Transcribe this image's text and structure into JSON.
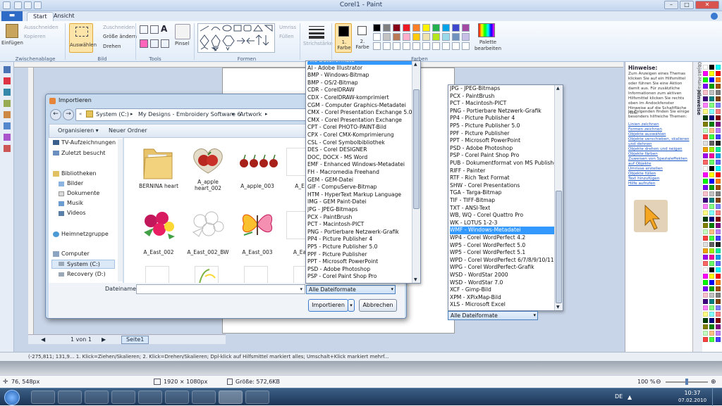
{
  "window": {
    "title": "Corel1 - Paint"
  },
  "tabs": {
    "menu": "▬",
    "start": "Start",
    "view": "Ansicht"
  },
  "ribbon": {
    "clipboard": {
      "paste": "Einfügen",
      "cut": "Ausschneiden",
      "copy": "Kopieren",
      "label": "Zwischenablage"
    },
    "image": {
      "select": "Auswählen",
      "crop": "Zuschneiden",
      "resize": "Größe ändern",
      "rotate": "Drehen",
      "label": "Bild"
    },
    "tools": {
      "label": "Tools"
    },
    "brushes": {
      "label": "Pinsel"
    },
    "shapes": {
      "outline": "Umriss",
      "fill": "Füllen",
      "label": "Formen"
    },
    "size": {
      "label": "Strichstärke"
    },
    "colors": {
      "color1": "1. Farbe",
      "color2": "2. Farbe",
      "edit": "Palette bearbeiten",
      "label": "Farben",
      "row1": [
        "#000000",
        "#7f7f7f",
        "#880015",
        "#ed1c24",
        "#ff7f27",
        "#fff200",
        "#22b14c",
        "#00a2e8",
        "#3f48cc",
        "#a349a4"
      ],
      "row2": [
        "#ffffff",
        "#c3c3c3",
        "#b97a57",
        "#ffaec9",
        "#ffc90e",
        "#efe4b0",
        "#b5e61d",
        "#99d9ea",
        "#7092be",
        "#c8bfe7"
      ]
    }
  },
  "dialog": {
    "title": "Importieren",
    "path": [
      "System (C:)",
      "My Designs - Embroidery Software 6",
      "Artwork"
    ],
    "organize": "Organisieren",
    "new_folder": "Neuer Ordner",
    "nav": [
      "TV-Aufzeichnungen",
      "Zuletzt besucht",
      "Bibliotheken",
      "Bilder",
      "Dokumente",
      "Musik",
      "Videos",
      "Heimnetzgruppe",
      "Computer",
      "System (C:)",
      "Recovery (D:)"
    ],
    "files": [
      "BERNINA heart",
      "A_apple heart_002",
      "A_apple_003",
      "A_E",
      "A_East_002",
      "A_East_002_BW",
      "A_East_003",
      "A_Ea"
    ],
    "filename_label": "Dateiname:",
    "filename_value": "",
    "filter": "Alle Dateiformate",
    "import_btn": "Importieren",
    "cancel_btn": "Abbrechen"
  },
  "list1": {
    "items": [
      "Alle Dateiformate",
      "AI - Adobe Illustrator",
      "BMP - Windows-Bitmap",
      "BMP - OS/2-Bitmap",
      "CDR - CorelDRAW",
      "CDX - CorelDRAW-komprimiert",
      "CGM - Computer Graphics-Metadatei",
      "CMX - Corel Presentation Exchange 5.0",
      "CMX - Corel Presentation Exchange",
      "CPT - Corel PHOTO-PAINT-Bild",
      "CPX - Corel CMX-Komprimierung",
      "CSL - Corel Symbolbibliothek",
      "DES - Corel DESIGNER",
      "DOC, DOCX - MS Word",
      "EMF - Enhanced Windows-Metadatei",
      "FH - Macromedia Freehand",
      "GEM - GEM-Datei",
      "GIF - CompuServe-Bitmap",
      "HTM - HyperText Markup Language",
      "IMG - GEM Paint-Datei",
      "JPG - JPEG-Bitmaps",
      "PCX - PaintBrush",
      "PCT - Macintosh-PICT",
      "PNG - Portierbare Netzwerk-Grafik",
      "PP4 - Picture Publisher 4",
      "PP5 - Picture Publisher 5.0",
      "PPF - Picture Publisher",
      "PPT - Microsoft PowerPoint",
      "PSD - Adobe Photoshop",
      "PSP - Corel Paint Shop Pro"
    ]
  },
  "list2": {
    "items": [
      "JPG - JPEG-Bitmaps",
      "PCX - PaintBrush",
      "PCT - Macintosh-PICT",
      "PNG - Portierbare Netzwerk-Grafik",
      "PP4 - Picture Publisher 4",
      "PP5 - Picture Publisher 5.0",
      "PPF - Picture Publisher",
      "PPT - Microsoft PowerPoint",
      "PSD - Adobe Photoshop",
      "PSP - Corel Paint Shop Pro",
      "PUB - Dokumentformat von MS Publisher",
      "RIFF - Painter",
      "RTF - Rich Text Format",
      "SHW - Corel Presentations",
      "TGA - Targa-Bitmap",
      "TIF - TIFF-Bitmap",
      "TXT - ANSI-Text",
      "WB, WQ - Corel Quattro Pro",
      "WK - LOTUS 1-2-3",
      "WMF - Windows-Metadatei",
      "WP4 - Corel WordPerfect 4.2",
      "WP5 - Corel WordPerfect 5.0",
      "WP5 - Corel WordPerfect 5.1",
      "WPD - Corel WordPerfect 6/7/8/9/10/11",
      "WPG - Corel WordPerfect-Grafik",
      "WSD - WordStar 2000",
      "WSD - WordStar 7.0",
      "XCF - Gimp-Bild",
      "XPM - XPixMap-Bild",
      "XLS - Microsoft Excel"
    ],
    "selected": "WMF - Windows-Metadatei",
    "filter": "Alle Dateiformate"
  },
  "hints": {
    "title": "Hinweise:",
    "body": "Zum Anzeigen eines Themas klicken Sie auf ein Hilfsmittel oder führen Sie eine Aktion damit aus. Für zusätzliche Informationen zum aktiven Hilfsmittel klicken Sie rechts oben im Andockfenster Hinweise auf die Schaltfläche Hilfe.",
    "subtitle": "Im Folgenden finden Sie einige besonders hilfreiche Themen:",
    "links": [
      "Linien zeichnen",
      "Formen zeichnen",
      "Objekte auswählen",
      "Objekte verschieben, skalieren und dehnen",
      "Objekte drehen und neigen",
      "Objekte färben",
      "Zuweisen von Spezialeffekten auf Objekte",
      "Umrisse erstellen",
      "Objekte füllen",
      "Text hinzufügen",
      "Hilfe aufrufen"
    ],
    "tab": "Hinweise",
    "tab2": "Objekt-Manager"
  },
  "corel": {
    "page_nav": "1 von 1",
    "page_tab": "Seite1",
    "status": "(-275,811; 131,9... 1. Klick=Ziehen/Skalieren; 2. Klick=Drehen/Skalieren; Dpl-klick auf Hilfsmittel markiert alles; Umschalt+Klick markiert mehrf..."
  },
  "paint_status": {
    "cursor": "76, 548px",
    "dims": "1920 × 1080px",
    "size": "Größe: 572,6KB",
    "zoom": "100 %"
  },
  "taskbar": {
    "lang": "DE",
    "time": "10:37",
    "date": "07.02.2010"
  }
}
